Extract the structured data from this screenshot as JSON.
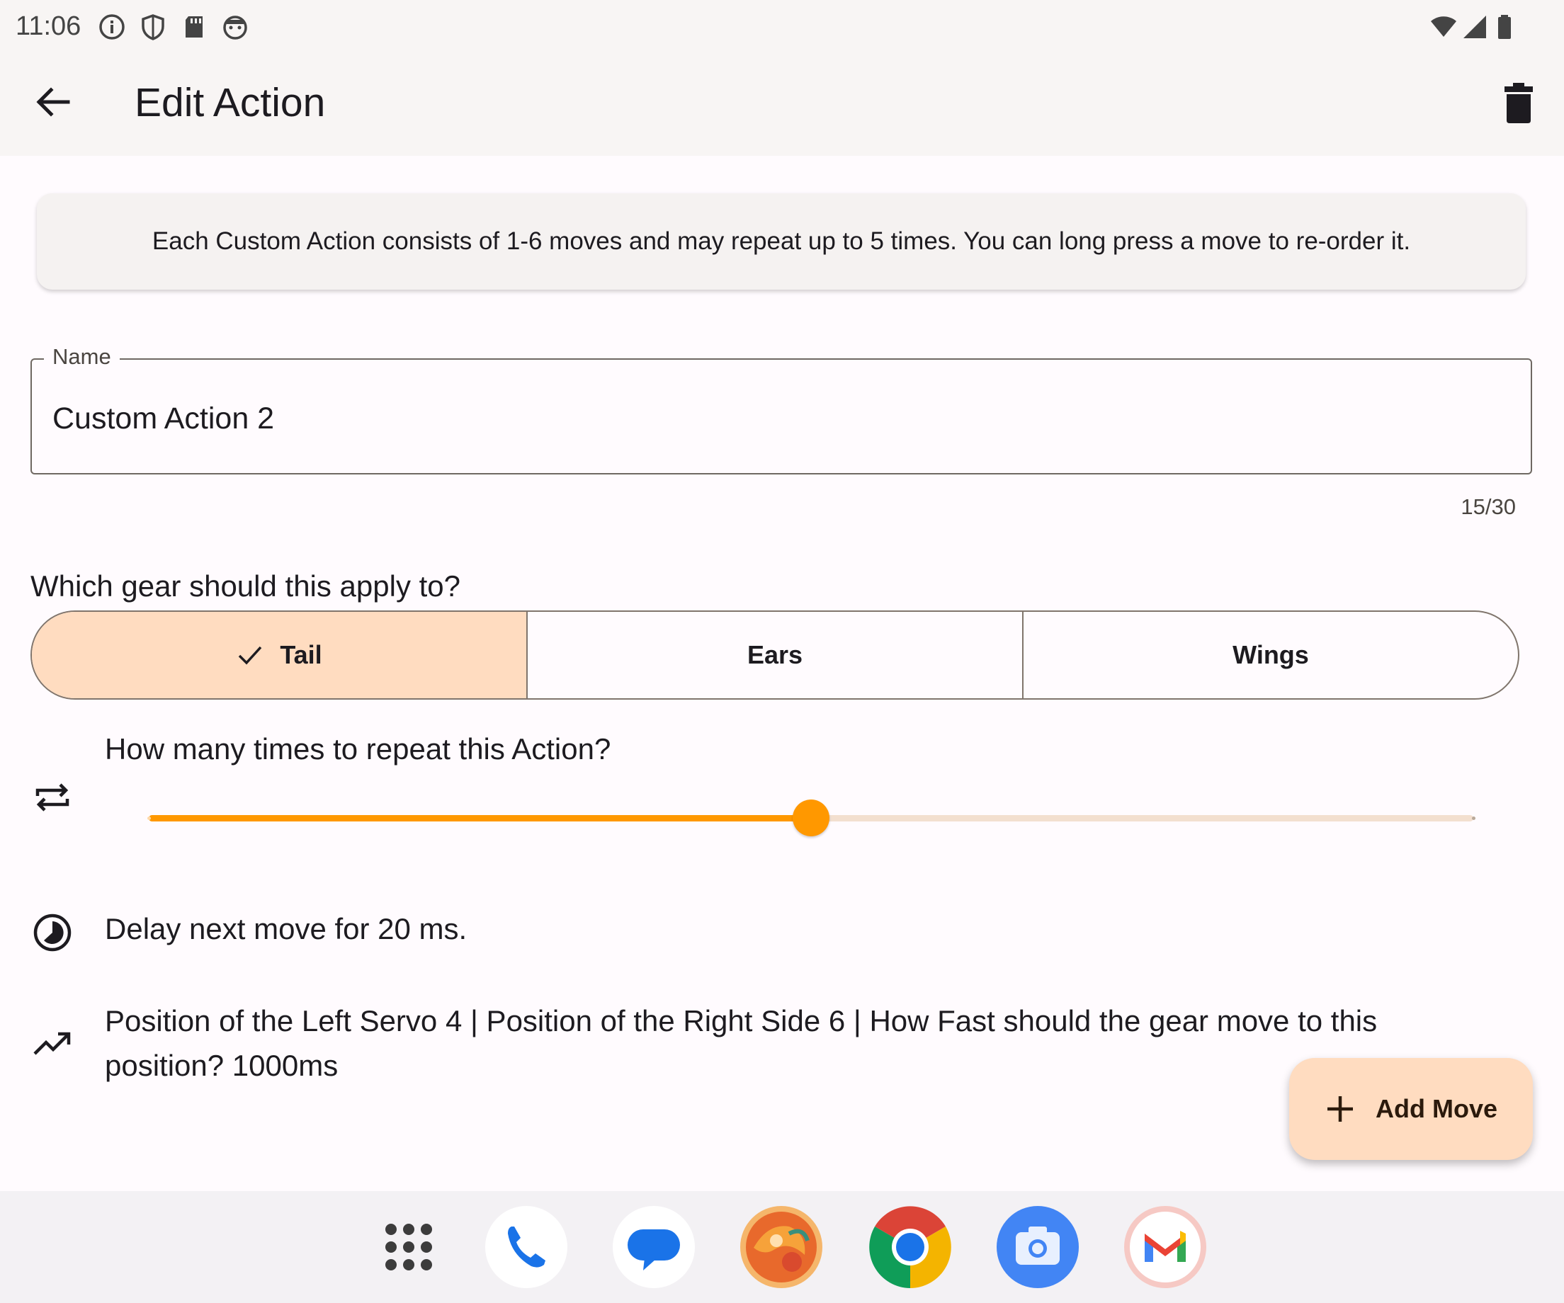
{
  "status_bar": {
    "time": "11:06",
    "left_icons": [
      "info-icon",
      "shield-icon",
      "sd-card-icon",
      "android-face-icon"
    ],
    "right_icons": [
      "wifi-icon",
      "cell-signal-icon",
      "battery-icon"
    ]
  },
  "app_bar": {
    "title": "Edit Action",
    "back_icon": "arrow-back-icon",
    "delete_icon": "trash-icon"
  },
  "info": {
    "text": "Each Custom Action consists of 1-6 moves and may repeat up to 5 times. You can long press a move to re-order it."
  },
  "name_field": {
    "label": "Name",
    "value": "Custom Action 2",
    "counter": "15/30"
  },
  "gear": {
    "question": "Which gear should this apply to?",
    "options": [
      {
        "label": "Tail",
        "selected": true
      },
      {
        "label": "Ears",
        "selected": false
      },
      {
        "label": "Wings",
        "selected": false
      }
    ]
  },
  "repeat": {
    "question": "How many times to repeat this Action?",
    "min": 1,
    "max": 5,
    "value": 3,
    "color": "#ff9800"
  },
  "moves": [
    {
      "icon": "clock-icon",
      "text": "Delay next move for 20 ms."
    },
    {
      "icon": "trending-up-icon",
      "text": "Position of the Left Servo 4 | Position of the Right Side 6 | How Fast should the gear move to this position? 1000ms"
    }
  ],
  "fab": {
    "label": "Add Move",
    "icon": "plus-icon"
  },
  "dock": {
    "apps": [
      "app-drawer-icon",
      "phone-icon",
      "messages-icon",
      "fox-app-icon",
      "chrome-icon",
      "camera-icon",
      "gmail-icon"
    ]
  },
  "colors": {
    "accent": "#ff9800",
    "selected_segment": "#ffdcc0",
    "fab": "#ffdcc0"
  }
}
